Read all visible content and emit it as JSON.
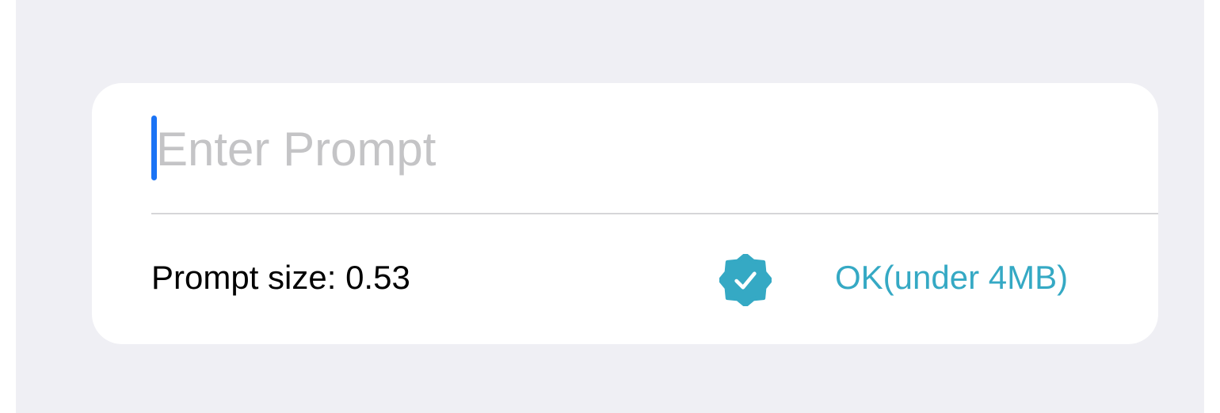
{
  "prompt": {
    "value": "",
    "placeholder": "Enter Prompt"
  },
  "size_info": {
    "label": "Prompt size: 0.53"
  },
  "status": {
    "icon": "verified-checkmark-badge-icon",
    "text": "OK(under 4MB)",
    "color": "#35a9c4"
  },
  "colors": {
    "background": "#efeff4",
    "card": "#ffffff",
    "cursor": "#1a73f5",
    "placeholder": "#c4c4c6"
  }
}
